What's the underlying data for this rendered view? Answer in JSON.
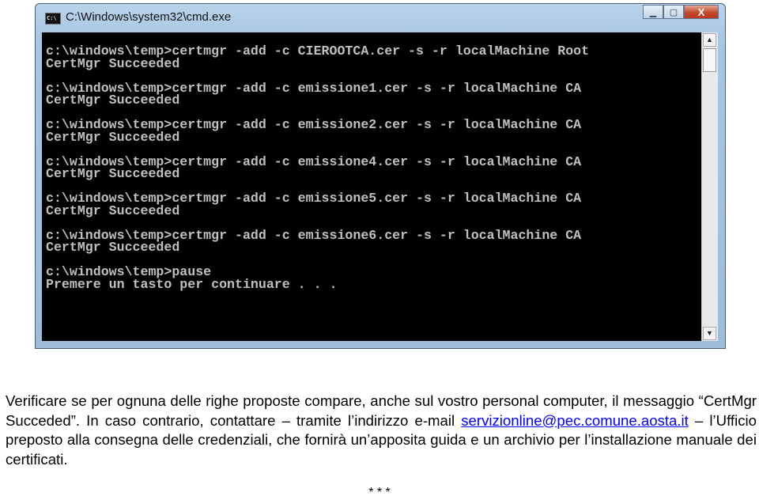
{
  "window": {
    "title": "C:\\Windows\\system32\\cmd.exe",
    "icon": "cmd-icon",
    "controls": [
      "minimize",
      "maximize",
      "close"
    ]
  },
  "console": {
    "lines": [
      "c:\\windows\\temp>certmgr -add -c CIEROOTCA.cer -s -r localMachine Root",
      "CertMgr Succeeded",
      "",
      "c:\\windows\\temp>certmgr -add -c emissione1.cer -s -r localMachine CA",
      "CertMgr Succeeded",
      "",
      "c:\\windows\\temp>certmgr -add -c emissione2.cer -s -r localMachine CA",
      "CertMgr Succeeded",
      "",
      "c:\\windows\\temp>certmgr -add -c emissione4.cer -s -r localMachine CA",
      "CertMgr Succeeded",
      "",
      "c:\\windows\\temp>certmgr -add -c emissione5.cer -s -r localMachine CA",
      "CertMgr Succeeded",
      "",
      "c:\\windows\\temp>certmgr -add -c emissione6.cer -s -r localMachine CA",
      "CertMgr Succeeded",
      "",
      "c:\\windows\\temp>pause",
      "Premere un tasto per continuare . . ."
    ]
  },
  "paragraph": {
    "text1": "Verificare se per ognuna delle righe proposte compare, anche sul vostro personal computer, il messaggio “CertMgr Succeded”. In caso contrario, contattare – tramite l’indirizzo e-mail ",
    "link": "servizionline@pec.comune.aosta.it",
    "text2": " – l’Ufficio preposto alla consegna delle credenziali, che fornirà un’apposita guida e un archivio per l’installazione manuale dei certificati."
  },
  "separator": "* * *"
}
